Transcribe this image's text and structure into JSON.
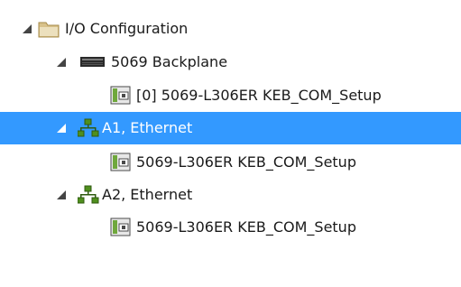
{
  "colors": {
    "selection_background": "#3399ff",
    "selection_text": "#ffffff",
    "text": "#1a1a1a",
    "network_icon": "#4f8f1e"
  },
  "tree": {
    "io_configuration": {
      "label": "I/O Configuration",
      "icon": "folder-icon",
      "expanded": true
    },
    "backplane": {
      "label": "5069 Backplane",
      "icon": "backplane-icon",
      "expanded": true
    },
    "backplane_module": {
      "label": "[0] 5069-L306ER KEB_COM_Setup",
      "icon": "controller-module-icon"
    },
    "a1_ethernet": {
      "label": "A1, Ethernet",
      "icon": "ethernet-network-icon",
      "expanded": true,
      "selected": true
    },
    "a1_module": {
      "label": "5069-L306ER KEB_COM_Setup",
      "icon": "controller-module-icon"
    },
    "a2_ethernet": {
      "label": "A2, Ethernet",
      "icon": "ethernet-network-icon",
      "expanded": true
    },
    "a2_module": {
      "label": "5069-L306ER KEB_COM_Setup",
      "icon": "controller-module-icon"
    }
  }
}
